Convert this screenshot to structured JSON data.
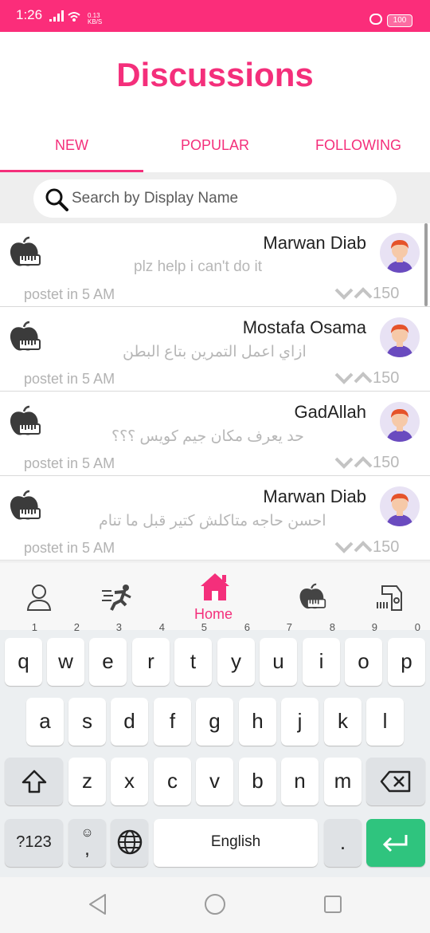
{
  "status_bar": {
    "time": "1:26",
    "net_speed": "0.13",
    "net_unit": "KB/S",
    "battery": "100"
  },
  "page": {
    "title": "Discussions"
  },
  "tabs": [
    {
      "label": "NEW",
      "active": true
    },
    {
      "label": "POPULAR",
      "active": false
    },
    {
      "label": "FOLLOWING",
      "active": false
    }
  ],
  "search": {
    "placeholder": "Search by Display Name"
  },
  "posts": [
    {
      "name": "Marwan Diab",
      "message": "plz help i can't do it",
      "posted": "postet in 5 AM",
      "votes": "150"
    },
    {
      "name": "Mostafa Osama",
      "message": "ازاي اعمل التمرين بتاع البطن",
      "posted": "postet in 5 AM",
      "votes": "150"
    },
    {
      "name": "GadAllah",
      "message": "حد يعرف مكان جيم كويس ؟؟؟",
      "posted": "postet in 5 AM",
      "votes": "150"
    },
    {
      "name": "Marwan Diab",
      "message": "احسن حاجه متاكلش كتير قبل ما تنام",
      "posted": "postet in 5 AM",
      "votes": "150"
    }
  ],
  "bottom_nav": {
    "items": [
      {
        "icon": "profile-icon"
      },
      {
        "icon": "workout-icon"
      },
      {
        "icon": "home-icon",
        "label": "Home",
        "active": true
      },
      {
        "icon": "nutrition-icon"
      },
      {
        "icon": "scale-icon"
      }
    ],
    "active_color": "#f42f7b"
  },
  "keyboard": {
    "row1": [
      {
        "key": "q",
        "hint": "1"
      },
      {
        "key": "w",
        "hint": "2"
      },
      {
        "key": "e",
        "hint": "3"
      },
      {
        "key": "r",
        "hint": "4"
      },
      {
        "key": "t",
        "hint": "5"
      },
      {
        "key": "y",
        "hint": "6"
      },
      {
        "key": "u",
        "hint": "7"
      },
      {
        "key": "i",
        "hint": "8"
      },
      {
        "key": "o",
        "hint": "9"
      },
      {
        "key": "p",
        "hint": "0"
      }
    ],
    "row2": [
      "a",
      "s",
      "d",
      "f",
      "g",
      "h",
      "j",
      "k",
      "l"
    ],
    "row3": [
      "z",
      "x",
      "c",
      "v",
      "b",
      "n",
      "m"
    ],
    "symbols_key": "?123",
    "comma_key": ",",
    "space_label": "English",
    "period_key": "."
  },
  "colors": {
    "accent": "#f42f7b",
    "status_bar": "#fb2d7a",
    "enter_key": "#2fc47e"
  }
}
